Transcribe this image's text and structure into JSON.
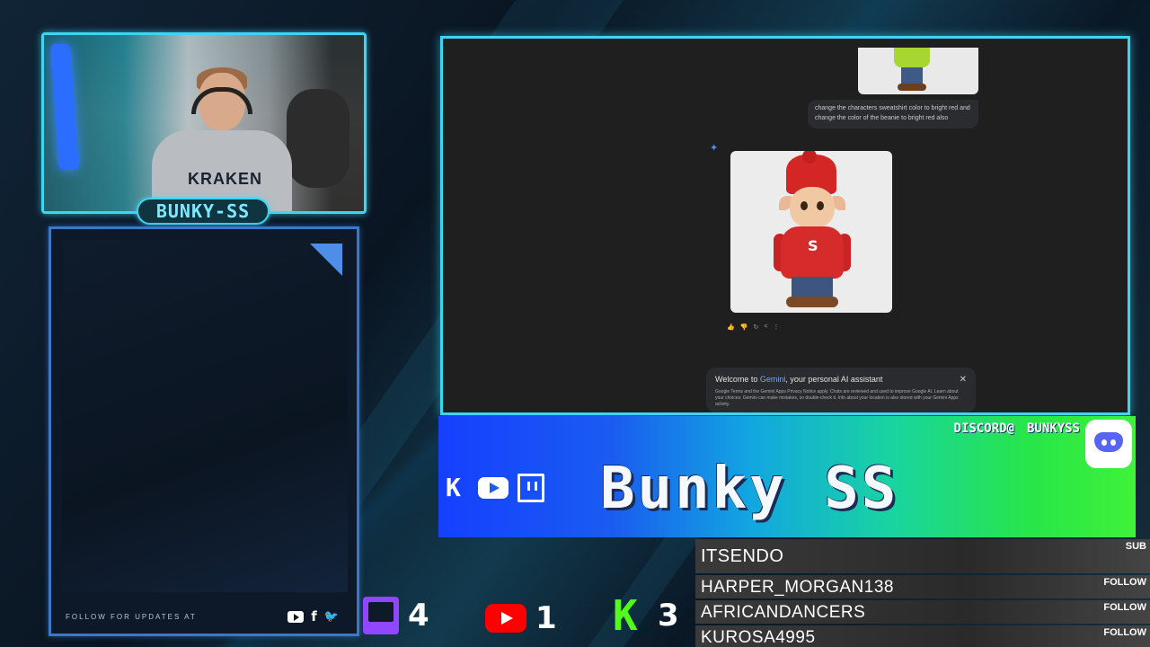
{
  "webcam": {
    "streamer_label": "BUNKY-SS",
    "hoodie_text": "KRAKEN"
  },
  "side_panel": {
    "follow_text": "FOLLOW FOR UPDATES AT",
    "social_icons": [
      "youtube-icon",
      "facebook-icon",
      "twitter-icon"
    ],
    "facebook_glyph": "f",
    "twitter_glyph": "🐦"
  },
  "gemini": {
    "prompt": "change the characters sweatshirt color to bright red and change the color of the beanie to bright red also",
    "sweatshirt_letter": "S",
    "actions": [
      "👍",
      "👎",
      "↻",
      "<",
      "⋮"
    ],
    "welcome_title_prefix": "Welcome to ",
    "welcome_brand": "Gemini",
    "welcome_title_suffix": ", your personal AI assistant",
    "welcome_body": "Google Terms and the Gemini Apps Privacy Notice apply. Chats are reviewed and used to improve Google AI. Learn about your choices. Gemini can make mistakes, so double-check it. Info about your location is also stored with your Gemini Apps activity.",
    "close_glyph": "✕",
    "spark_glyph": "✦"
  },
  "banner": {
    "title": "Bunky SS",
    "discord_label": "DISCORD@",
    "discord_handle": "BUNKYSS",
    "kick_glyph": "K",
    "colors": {
      "left": "#1540ff",
      "right": "#3ff23a"
    }
  },
  "counters": [
    {
      "platform": "twitch",
      "value": "4"
    },
    {
      "platform": "youtube",
      "value": "1"
    },
    {
      "platform": "kick",
      "value": "3",
      "glyph": "K"
    }
  ],
  "feed": [
    {
      "name": "ITSENDO",
      "type": "SUB"
    },
    {
      "name": "HARPER_MORGAN138",
      "type": "FOLLOW"
    },
    {
      "name": "AFRICANDANCERS",
      "type": "FOLLOW"
    },
    {
      "name": "KUROSA4995",
      "type": "FOLLOW"
    }
  ]
}
